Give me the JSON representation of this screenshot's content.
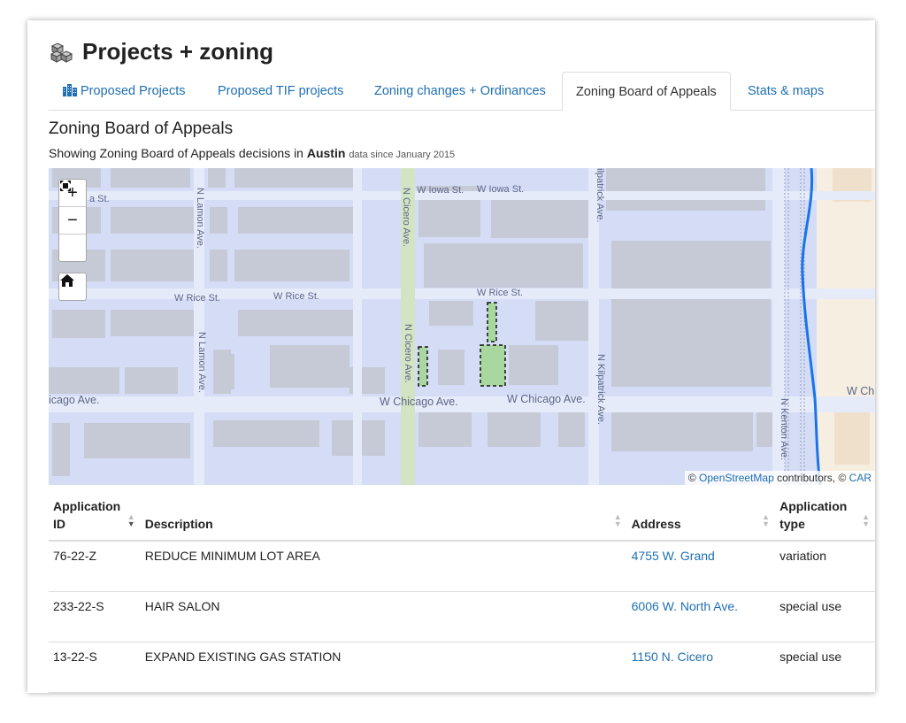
{
  "page": {
    "title": "Projects + zoning"
  },
  "tabs": [
    {
      "label": "Proposed Projects"
    },
    {
      "label": "Proposed TIF projects"
    },
    {
      "label": "Zoning changes + Ordinances"
    },
    {
      "label": "Zoning Board of Appeals"
    },
    {
      "label": "Stats & maps"
    }
  ],
  "section": {
    "title": "Zoning Board of Appeals",
    "showing_prefix": "Showing Zoning Board of Appeals decisions in",
    "area": "Austin",
    "since": "data since January 2015"
  },
  "map": {
    "controls": {
      "zoom_in": "+",
      "zoom_out": "−"
    },
    "streets": {
      "iowa_1": "W Iowa St.",
      "iowa_2": "W Iowa St.",
      "iowa_west": "a St.",
      "rice_1": "W Rice St.",
      "rice_2": "W Rice St.",
      "rice_3": "W Rice St.",
      "chicago_1": "icago Ave.",
      "chicago_2": "W Chicago Ave.",
      "chicago_3": "W Chicago Ave.",
      "chicago_east": "W Ch",
      "lamon_1": "N Lamon Ave.",
      "lamon_2": "N Lamon Ave.",
      "cicero_1": "N Cicero Ave.",
      "cicero_2": "N Cicero Ave.",
      "kilpatrick_1": "ilpatrick Ave.",
      "kilpatrick_2": "N Kilpatrick Ave.",
      "kenton": "N Kenton Ave."
    },
    "attribution": {
      "prefix": "©",
      "osm": "OpenStreetMap",
      "mid": "contributors, ©",
      "carto": "CAR"
    },
    "colors": {
      "water": "#1a73e8",
      "parcel_fill": "#a8d8a0",
      "base": "#d4ddf5",
      "building": "#c6cad7"
    }
  },
  "table": {
    "headers": {
      "id": "Application ID",
      "description": "Description",
      "address": "Address",
      "type": "Application type"
    },
    "rows": [
      {
        "id": "76-22-Z",
        "description": "REDUCE MINIMUM LOT AREA",
        "address": "4755 W. Grand",
        "type": "variation"
      },
      {
        "id": "233-22-S",
        "description": "HAIR SALON",
        "address": "6006 W. North Ave.",
        "type": "special use"
      },
      {
        "id": "13-22-S",
        "description": "EXPAND EXISTING GAS STATION",
        "address": "1150 N. Cicero",
        "type": "special use"
      }
    ]
  },
  "icons": [
    "blocks-icon",
    "building-icon",
    "zoom-in-icon",
    "zoom-out-icon",
    "fullscreen-icon",
    "home-icon",
    "sort-icon"
  ]
}
